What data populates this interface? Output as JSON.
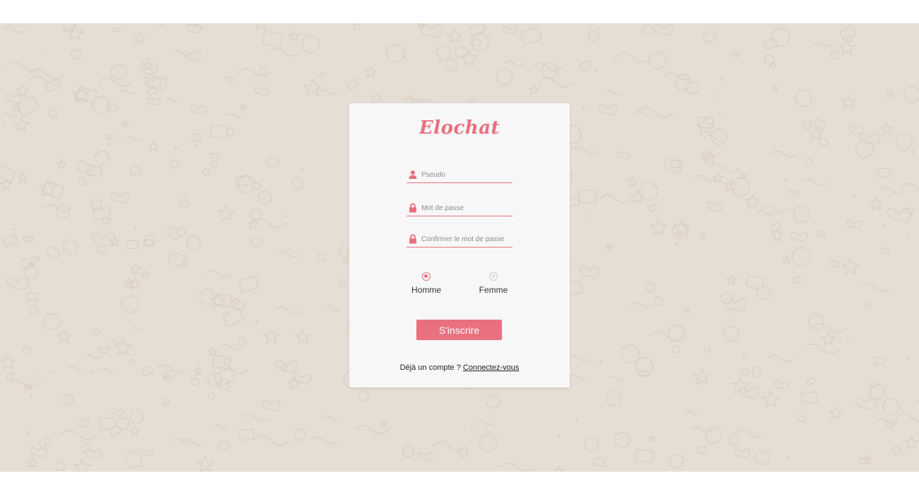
{
  "colors": {
    "accent": "#e8707f",
    "background": "#e6ddd5",
    "doodle": "#d6c9bd",
    "card": "#f7f7f7"
  },
  "app": {
    "logo_text": "Elochat"
  },
  "form": {
    "username": {
      "icon": "user-icon",
      "placeholder": "Pseudo",
      "value": ""
    },
    "password": {
      "icon": "lock-icon",
      "placeholder": "Mot de passe",
      "value": ""
    },
    "confirm_password": {
      "icon": "lock-icon",
      "placeholder": "Confirmer le mot de passe",
      "value": ""
    },
    "gender": {
      "options": [
        {
          "label": "Homme",
          "selected": true
        },
        {
          "label": "Femme",
          "selected": false
        }
      ]
    },
    "submit_label": "S'inscrire"
  },
  "footer": {
    "prompt": "Déjà un compte ?",
    "link_label": "Connectez-vous"
  }
}
